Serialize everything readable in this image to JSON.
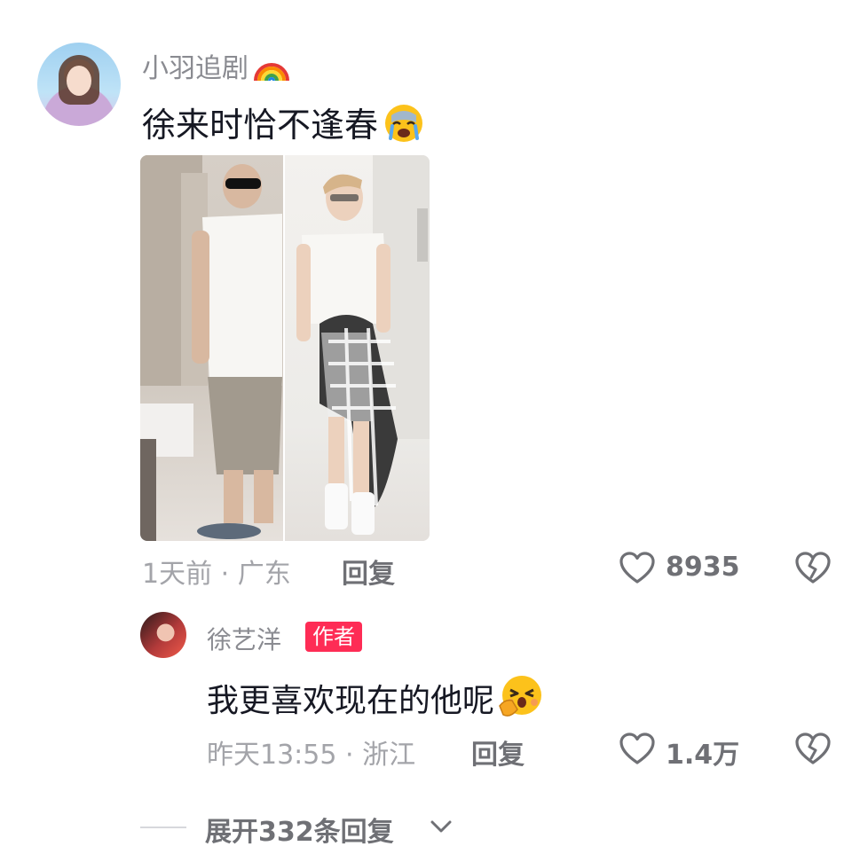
{
  "comment": {
    "username": "小羽追剧",
    "username_emoji": "rainbow-icon",
    "text": "徐来时恰不逢春",
    "text_emoji": "crying-face-icon",
    "time_location": "1天前 · 广东",
    "reply_label": "回复",
    "like_count": "8935"
  },
  "reply": {
    "username": "徐艺洋",
    "badge": "作者",
    "text": "我更喜欢现在的他呢",
    "text_emoji": "shy-hand-over-mouth-icon",
    "time_location": "昨天13:55 · 浙江",
    "reply_label": "回复",
    "like_count": "1.4万"
  },
  "expand": {
    "label": "展开332条回复"
  },
  "colors": {
    "badge": "#fe2c55",
    "muted_text": "#a3a4a9",
    "action_text": "#6f7075",
    "primary_text": "#161823"
  }
}
